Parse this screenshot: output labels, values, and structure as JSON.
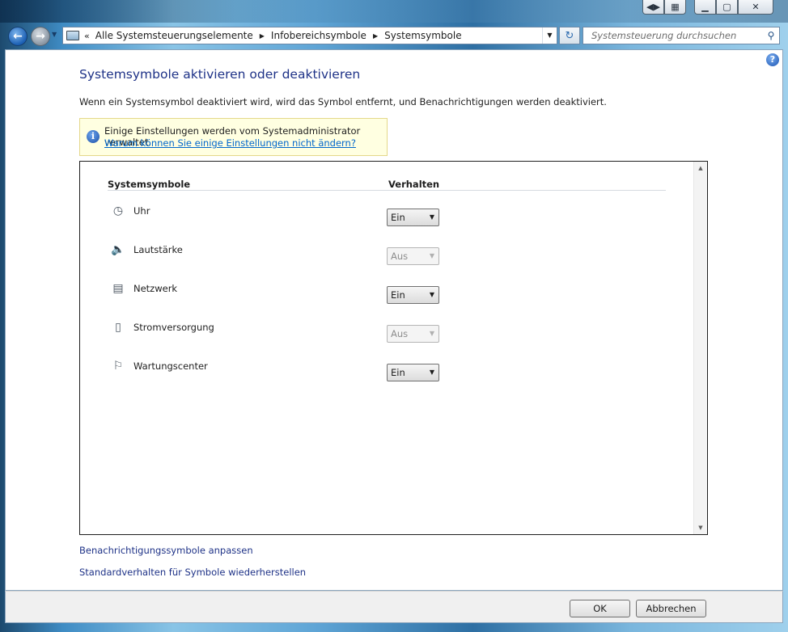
{
  "window": {
    "buttons": {
      "back": "◀▶",
      "notes": "▦",
      "minimize": "▁",
      "maximize": "▢",
      "close": "✕"
    }
  },
  "navigation": {
    "breadcrumb": [
      "Alle Systemsteuerungselemente",
      "Infobereichsymbole",
      "Systemsymbole"
    ],
    "search_placeholder": "Systemsteuerung durchsuchen"
  },
  "page": {
    "title": "Systemsymbole aktivieren oder deaktivieren",
    "description": "Wenn ein Systemsymbol deaktiviert wird, wird das Symbol entfernt, und Benachrichtigungen werden deaktiviert.",
    "info": {
      "message": "Einige Einstellungen werden vom Systemadministrator verwaltet.",
      "link": "Warum können Sie einige Einstellungen nicht ändern?"
    },
    "columns": {
      "symbols": "Systemsymbole",
      "behavior": "Verhalten"
    },
    "rows": [
      {
        "label": "Uhr",
        "icon": "clock-icon",
        "value": "Ein",
        "enabled": true
      },
      {
        "label": "Lautstärke",
        "icon": "speaker-icon",
        "value": "Aus",
        "enabled": false
      },
      {
        "label": "Netzwerk",
        "icon": "network-icon",
        "value": "Ein",
        "enabled": true
      },
      {
        "label": "Stromversorgung",
        "icon": "power-icon",
        "value": "Aus",
        "enabled": false
      },
      {
        "label": "Wartungscenter",
        "icon": "flag-icon",
        "value": "Ein",
        "enabled": true
      }
    ],
    "links": {
      "customize": "Benachrichtigungssymbole anpassen",
      "restore": "Standardverhalten für Symbole wiederherstellen"
    }
  },
  "footer": {
    "ok": "OK",
    "cancel": "Abbrechen"
  }
}
